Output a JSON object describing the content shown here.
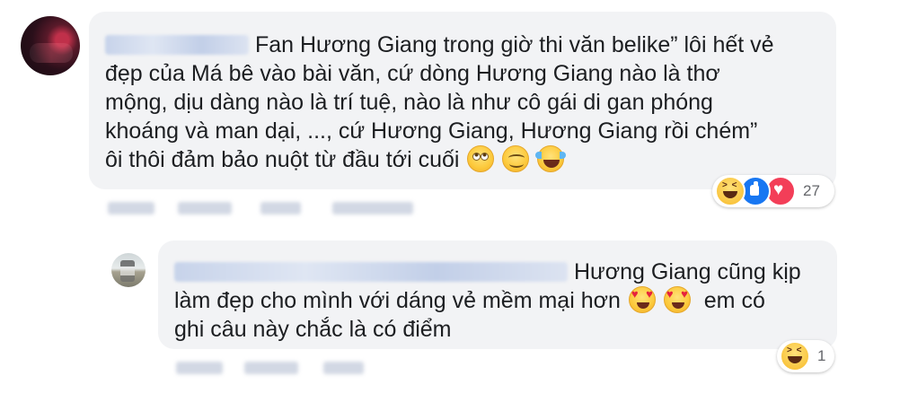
{
  "comment": {
    "text_lines": [
      "Fan Hương Giang trong giờ thi văn belike” lôi hết vẻ",
      "đẹp của Má bê vào bài văn, cứ dòng Hương Giang nào là thơ",
      "mộng, dịu dàng nào là trí tuệ, nào là như cô gái di gan phóng",
      "khoáng và man dại, ..., cứ Hương Giang, Hương Giang rồi chém”",
      "ôi thôi đảm bảo nuột từ đầu tới cuối"
    ],
    "emojis": [
      "rolling-eyes-emoji",
      "smiling-emoji",
      "tears-of-joy-emoji"
    ],
    "reactions": [
      "haha-icon",
      "like-icon",
      "love-icon"
    ],
    "reaction_count": "27"
  },
  "reply": {
    "text_lines": [
      "Hương Giang cũng kịp",
      "làm đẹp cho mình với dáng vẻ mềm mại hơn",
      "em có",
      "ghi câu này chắc là có điểm"
    ],
    "emojis": [
      "heart-eyes-emoji",
      "heart-eyes-emoji"
    ],
    "reactions": [
      "haha-icon"
    ],
    "reaction_count": "1"
  },
  "colors": {
    "bubble": "#f2f3f5",
    "text": "#1c1e21",
    "muted": "#65676b",
    "like": "#1877f2",
    "love": "#f33e58",
    "haha": "#f7b928"
  }
}
